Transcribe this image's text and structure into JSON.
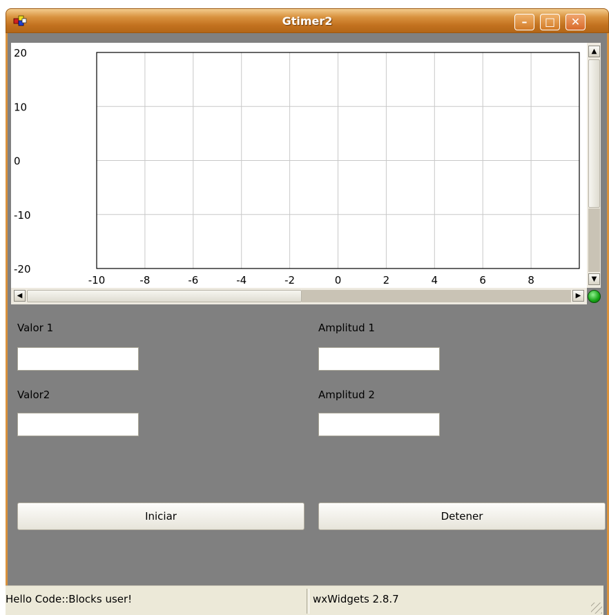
{
  "window": {
    "title": "Gtimer2",
    "minimize_glyph": "–",
    "maximize_glyph": "□",
    "close_glyph": "✕"
  },
  "chart_data": {
    "type": "line",
    "x_ticks": [
      "-10",
      "-8",
      "-6",
      "-4",
      "-2",
      "0",
      "2",
      "4",
      "6",
      "8"
    ],
    "y_ticks": [
      "20",
      "10",
      "0",
      "-10",
      "-20"
    ],
    "xlim": [
      -10,
      10
    ],
    "ylim": [
      -20,
      20
    ],
    "grid": true,
    "series": []
  },
  "form": {
    "valor1_label": "Valor 1",
    "valor1_value": "",
    "amplitud1_label": "Amplitud 1",
    "amplitud1_value": "",
    "valor2_label": "Valor2",
    "valor2_value": "",
    "amplitud2_label": "Amplitud 2",
    "amplitud2_value": ""
  },
  "buttons": {
    "start": "Iniciar",
    "stop": "Detener"
  },
  "statusbar": {
    "left": "Hello Code::Blocks user!",
    "right": "wxWidgets 2.8.7"
  },
  "colors": {
    "titlebar": "#d8913d",
    "background": "#808080",
    "led": "#14a214"
  }
}
